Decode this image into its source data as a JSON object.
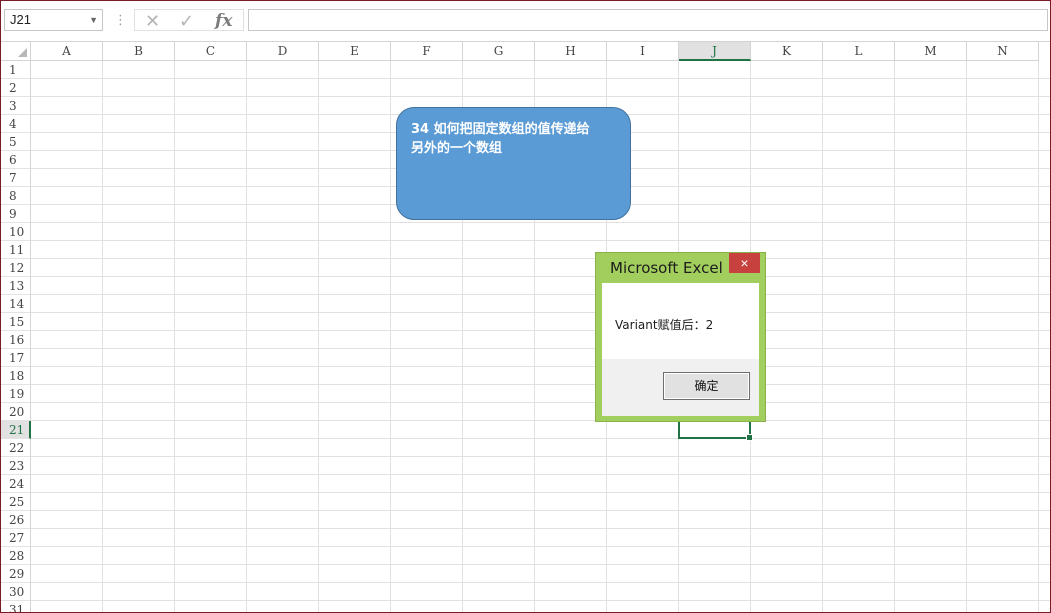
{
  "formula_bar": {
    "name_box": "J21",
    "separator": "⋮",
    "cancel_icon": "close-icon",
    "enter_icon": "check-icon",
    "fx_label": "fx",
    "formula": ""
  },
  "columns": [
    "A",
    "B",
    "C",
    "D",
    "E",
    "F",
    "G",
    "H",
    "I",
    "J",
    "K",
    "L",
    "M",
    "N"
  ],
  "rows": [
    "1",
    "2",
    "3",
    "4",
    "5",
    "6",
    "7",
    "8",
    "9",
    "10",
    "11",
    "12",
    "13",
    "14",
    "15",
    "16",
    "17",
    "18",
    "19",
    "20",
    "21",
    "22",
    "23",
    "24",
    "25",
    "26",
    "27",
    "28",
    "29",
    "30",
    "31"
  ],
  "active_cell": {
    "column": "J",
    "row": "21"
  },
  "shape": {
    "text_line1": "34  如何把固定数组的值传递给",
    "text_line2": "另外的一个数组",
    "fill_color": "#5b9bd5"
  },
  "dialog": {
    "title": "Microsoft Excel",
    "close_label": "×",
    "message": "Variant赋值后：2",
    "ok_label": "确定",
    "frame_color": "#a2ce5d"
  },
  "accent_color": "#217346"
}
